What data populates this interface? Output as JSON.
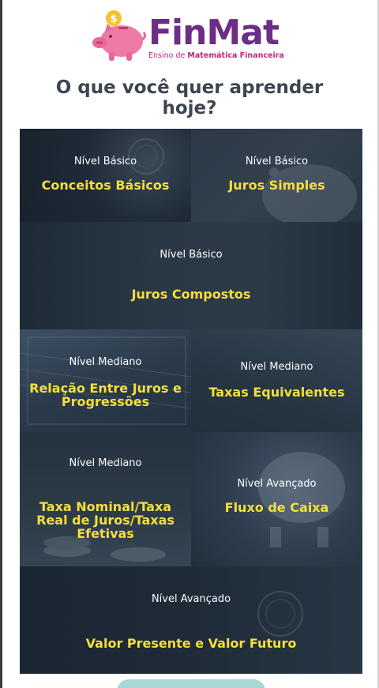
{
  "brand": {
    "name": "FinMat",
    "tagline_prefix": "Ensino de ",
    "tagline_bold": "Matemática Financeira"
  },
  "headline": "O que você quer aprender hoje?",
  "tiles": [
    {
      "level": "Nível Básico",
      "title": "Conceitos Básicos"
    },
    {
      "level": "Nível Básico",
      "title": "Juros Simples"
    },
    {
      "level": "Nível Básico",
      "title": "Juros Compostos"
    },
    {
      "level": "Nível Mediano",
      "title": "Relação Entre Juros e Progressões"
    },
    {
      "level": "Nível Mediano",
      "title": "Taxas Equivalentes"
    },
    {
      "level": "Nível Mediano",
      "title": "Taxa Nominal/Taxa Real de Juros/Taxas Efetivas"
    },
    {
      "level": "Nível Avançado",
      "title": "Fluxo de Caixa"
    },
    {
      "level": "Nível Avançado",
      "title": "Valor Presente e Valor Futuro"
    }
  ],
  "colors": {
    "brand_purple": "#6c2d86",
    "brand_pink": "#c2267a",
    "tile_title": "#f5df3a",
    "tile_bg": "#1f2c3a"
  }
}
